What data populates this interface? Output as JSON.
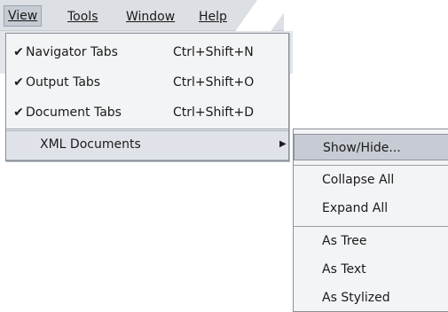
{
  "menubar": {
    "items": [
      {
        "label": "View",
        "mnemonic_index": 0
      },
      {
        "label": "Tools",
        "mnemonic_index": 0
      },
      {
        "label": "Window",
        "mnemonic_index": 0
      },
      {
        "label": "Help",
        "mnemonic_index": 0
      }
    ]
  },
  "view_menu": {
    "items": [
      {
        "label": "Navigator Tabs",
        "mnemonic": "N",
        "checked": true,
        "accelerator": "Ctrl+Shift+N"
      },
      {
        "label": "Output Tabs",
        "mnemonic": "O",
        "checked": true,
        "accelerator": "Ctrl+Shift+O"
      },
      {
        "label": "Document Tabs",
        "mnemonic": "T",
        "checked": true,
        "accelerator": "Ctrl+Shift+D"
      },
      {
        "label": "XML Documents",
        "mnemonic": "D",
        "checked": false,
        "accelerator": "",
        "submenu_arrow": "▶"
      }
    ]
  },
  "xml_submenu": {
    "items": [
      {
        "label": "Show/Hide...",
        "mnemonic": "S",
        "highlighted": true
      },
      {
        "label": "Collapse All",
        "mnemonic": "o"
      },
      {
        "label": "Expand All",
        "mnemonic": "p"
      },
      {
        "label": "As Tree",
        "mnemonic": "r"
      },
      {
        "label": "As Text",
        "mnemonic": "x"
      },
      {
        "label": "As Stylized",
        "mnemonic": "z"
      }
    ]
  },
  "glyphs": {
    "check": "✔"
  }
}
